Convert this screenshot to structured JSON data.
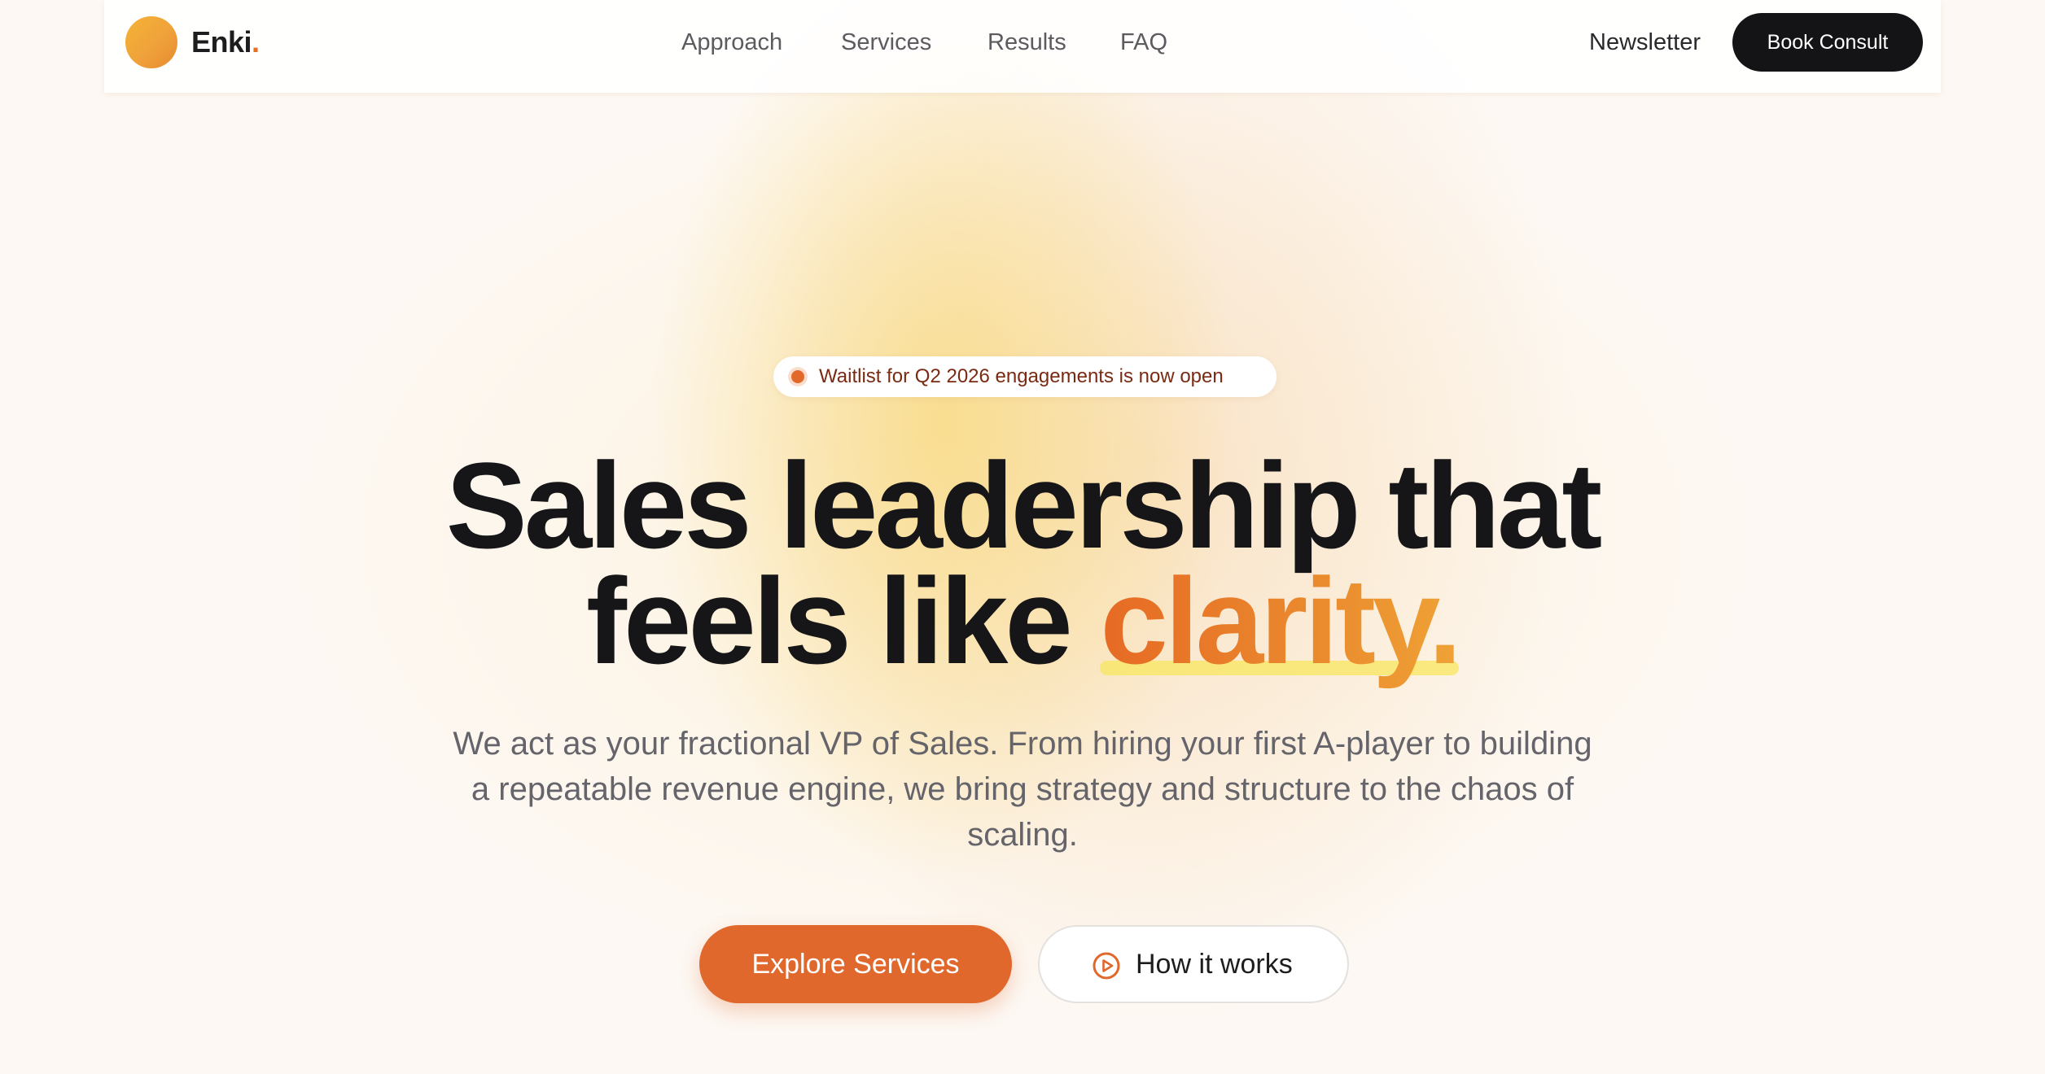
{
  "brand": {
    "name": "Enki",
    "dot": ".",
    "accent_color": "#e66d24"
  },
  "nav": {
    "links": [
      {
        "label": "Approach"
      },
      {
        "label": "Services"
      },
      {
        "label": "Results"
      },
      {
        "label": "FAQ"
      }
    ],
    "newsletter_label": "Newsletter",
    "cta_label": "Book Consult"
  },
  "hero": {
    "badge_text": "Waitlist for Q2 2026 engagements is now open",
    "headline_line1": "Sales leadership that",
    "headline_line2_prefix": "feels like ",
    "headline_accent": "clarity.",
    "subheadline": "We act as your fractional VP of Sales. From hiring your first A-player to building a repeatable revenue engine, we bring strategy and structure to the chaos of scaling.",
    "primary_cta": "Explore Services",
    "secondary_cta": "How it works",
    "secondary_cta_icon": "play-circle-icon"
  },
  "colors": {
    "primary": "#e0682c",
    "dark": "#141416",
    "highlight": "#f8e668"
  }
}
